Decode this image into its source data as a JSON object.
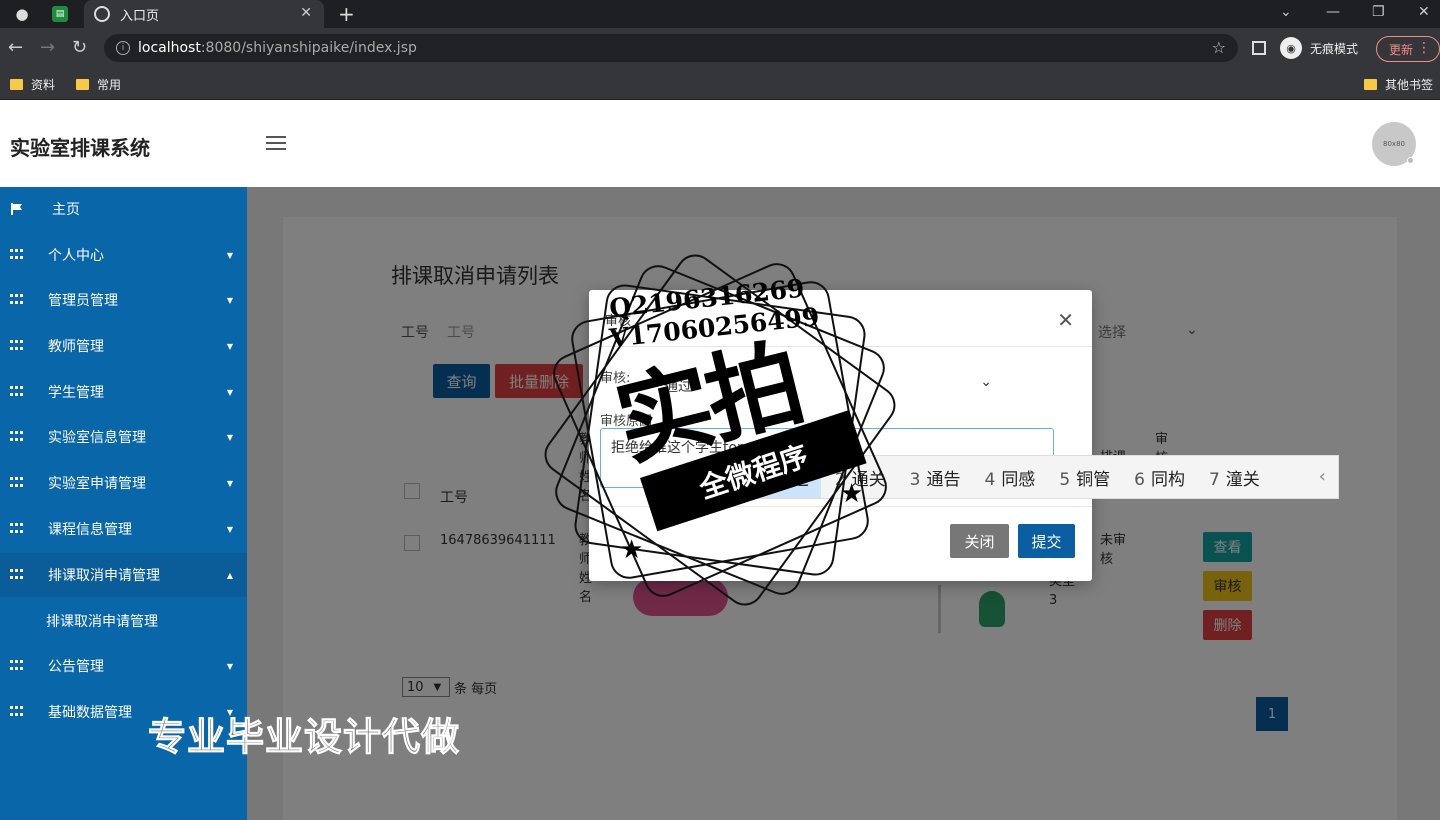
{
  "browser": {
    "tab_title": "入口页",
    "url_host": "localhost",
    "url_path": ":8080/shiyanshipaike/index.jsp",
    "incognito_label": "无痕模式",
    "update_label": "更新",
    "bookmarks": [
      "资料",
      "常用"
    ],
    "other_bookmarks": "其他书签"
  },
  "header": {
    "title": "实验室排课系统",
    "avatar_text": "80x80"
  },
  "sidebar": {
    "items": [
      {
        "label": "主页"
      },
      {
        "label": "个人中心"
      },
      {
        "label": "管理员管理"
      },
      {
        "label": "教师管理"
      },
      {
        "label": "学生管理"
      },
      {
        "label": "实验室信息管理"
      },
      {
        "label": "实验室申请管理"
      },
      {
        "label": "课程信息管理"
      },
      {
        "label": "排课取消申请管理"
      },
      {
        "label": "公告管理"
      },
      {
        "label": "基础数据管理"
      }
    ],
    "sub_item": "排课取消申请管理"
  },
  "main": {
    "page_title": "排课取消申请列表",
    "filter_label": "工号",
    "filter_placeholder": "工号",
    "filter_select_hint": "选择",
    "query_button": "查询",
    "batch_delete_button": "批量删除",
    "table_header_id": "工号",
    "table_header_partial": "教师姓名",
    "table_header_type": "排课",
    "table_header_audit": "审核",
    "row": {
      "id": "16478639641111",
      "teacher_partial": "教师姓名",
      "type": "类型3",
      "status": "未审核"
    },
    "actions": {
      "view": "查看",
      "audit": "审核",
      "delete": "删除"
    },
    "page_size": "10",
    "page_size_suffix": "条 每页",
    "current_page": "1"
  },
  "modal": {
    "title": "审核",
    "select_label": "审核:",
    "select_value": "通过",
    "reason_label": "审核原因",
    "reason_value": "拒绝给谁这个学生tong",
    "close_button": "关闭",
    "submit_button": "提交"
  },
  "ime": {
    "candidates": [
      {
        "n": "1",
        "text": "通过"
      },
      {
        "n": "2",
        "text": "通关"
      },
      {
        "n": "3",
        "text": "通告"
      },
      {
        "n": "4",
        "text": "同感"
      },
      {
        "n": "5",
        "text": "铜管"
      },
      {
        "n": "6",
        "text": "同构"
      },
      {
        "n": "7",
        "text": "潼关"
      }
    ]
  },
  "watermark": {
    "line1": "Q2196316269",
    "line2": "V17060256499",
    "big": "实拍",
    "banner": "全微程序",
    "bottom": "专业毕业设计代做"
  }
}
